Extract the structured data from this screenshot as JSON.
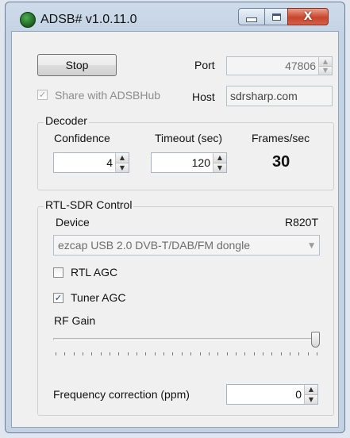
{
  "window": {
    "title": "ADSB# v1.0.11.0",
    "close_glyph": "X"
  },
  "controls": {
    "stop_label": "Stop",
    "port_label": "Port",
    "port_value": "47806",
    "share_label": "Share with ADSBHub",
    "share_checked": true,
    "host_label": "Host",
    "host_value": "sdrsharp.com"
  },
  "decoder": {
    "group_label": "Decoder",
    "confidence_label": "Confidence",
    "confidence_value": "4",
    "timeout_label": "Timeout (sec)",
    "timeout_value": "120",
    "fps_label": "Frames/sec",
    "fps_value": "30"
  },
  "rtl": {
    "group_label": "RTL-SDR Control",
    "device_label": "Device",
    "tuner_name": "R820T",
    "device_selected": "ezcap USB 2.0 DVB-T/DAB/FM dongle",
    "rtl_agc_label": "RTL AGC",
    "rtl_agc_checked": false,
    "tuner_agc_label": "Tuner AGC",
    "tuner_agc_checked": true,
    "rf_gain_label": "RF Gain",
    "rf_gain_level": 1.0,
    "freq_corr_label": "Frequency correction (ppm)",
    "freq_corr_value": "0"
  },
  "glyphs": {
    "check": "✓",
    "up": "▲",
    "down": "▼",
    "combo_arrow": "▼"
  },
  "colors": {
    "title_bg": "#c4d3e4",
    "close_button": "#c8452b",
    "client_bg": "#f0f0f0"
  }
}
